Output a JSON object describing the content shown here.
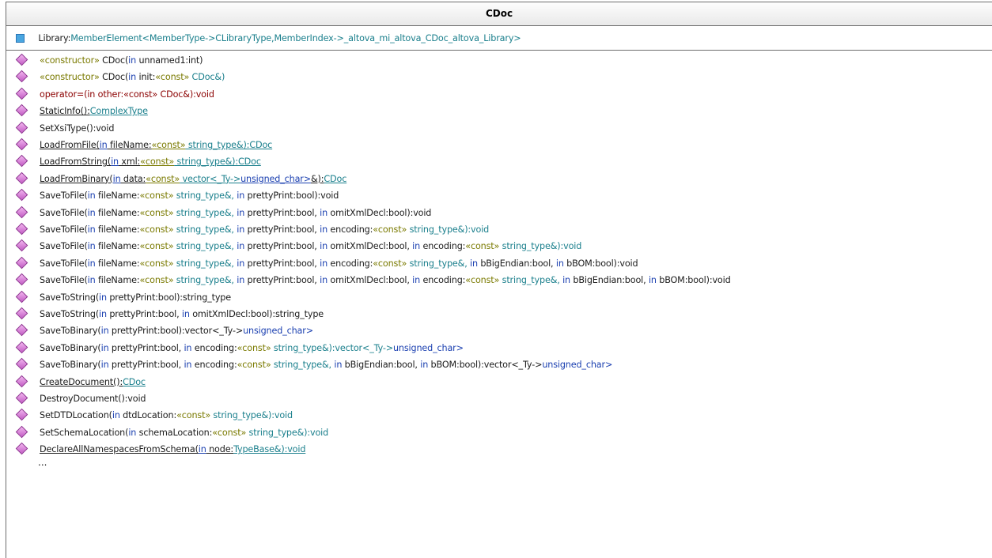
{
  "class_name": "CDoc",
  "attribute": [
    {
      "t": "Library:",
      "c": "plain"
    },
    {
      "t": "MemberElement<MemberType->CLibraryType,MemberIndex->_altova_mi_altova_CDoc_altova_Library>",
      "c": "ty"
    }
  ],
  "operations": [
    {
      "u": false,
      "parts": [
        {
          "t": "«constructor»",
          "c": "st"
        },
        {
          "t": " CDoc(",
          "c": "plain"
        },
        {
          "t": "in",
          "c": "kw"
        },
        {
          "t": " unnamed1:int)",
          "c": "plain"
        }
      ]
    },
    {
      "u": false,
      "parts": [
        {
          "t": "«constructor»",
          "c": "st"
        },
        {
          "t": " CDoc(",
          "c": "plain"
        },
        {
          "t": "in",
          "c": "kw"
        },
        {
          "t": " init:",
          "c": "plain"
        },
        {
          "t": "«const»",
          "c": "st"
        },
        {
          "t": " CDoc&)",
          "c": "ty"
        }
      ]
    },
    {
      "u": false,
      "parts": [
        {
          "t": "operator=(in other:«const» CDoc&):void",
          "c": "red"
        }
      ]
    },
    {
      "u": true,
      "parts": [
        {
          "t": "StaticInfo():",
          "c": "plain"
        },
        {
          "t": "ComplexType",
          "c": "ty"
        }
      ]
    },
    {
      "u": false,
      "parts": [
        {
          "t": "SetXsiType():void",
          "c": "plain"
        }
      ]
    },
    {
      "u": true,
      "parts": [
        {
          "t": "LoadFromFile(",
          "c": "plain"
        },
        {
          "t": "in",
          "c": "kw"
        },
        {
          "t": " fileName:",
          "c": "plain"
        },
        {
          "t": "«const»",
          "c": "st"
        },
        {
          "t": " string_type&):",
          "c": "ty"
        },
        {
          "t": "CDoc",
          "c": "ty"
        }
      ]
    },
    {
      "u": true,
      "parts": [
        {
          "t": "LoadFromString(",
          "c": "plain"
        },
        {
          "t": "in",
          "c": "kw"
        },
        {
          "t": " xml:",
          "c": "plain"
        },
        {
          "t": "«const»",
          "c": "st"
        },
        {
          "t": " string_type&):",
          "c": "ty"
        },
        {
          "t": "CDoc",
          "c": "ty"
        }
      ]
    },
    {
      "u": true,
      "parts": [
        {
          "t": "LoadFromBinary(",
          "c": "plain"
        },
        {
          "t": "in",
          "c": "kw"
        },
        {
          "t": " data:",
          "c": "plain"
        },
        {
          "t": "«const»",
          "c": "st"
        },
        {
          "t": " vector<_Ty->",
          "c": "ty"
        },
        {
          "t": "unsigned_char>",
          "c": "kw"
        },
        {
          "t": "&):",
          "c": "plain"
        },
        {
          "t": "CDoc",
          "c": "ty"
        }
      ]
    },
    {
      "u": false,
      "parts": [
        {
          "t": "SaveToFile(",
          "c": "plain"
        },
        {
          "t": "in",
          "c": "kw"
        },
        {
          "t": " fileName:",
          "c": "plain"
        },
        {
          "t": "«const»",
          "c": "st"
        },
        {
          "t": " string_type&, ",
          "c": "ty"
        },
        {
          "t": "in",
          "c": "kw"
        },
        {
          "t": " prettyPrint:bool):void",
          "c": "plain"
        }
      ]
    },
    {
      "u": false,
      "parts": [
        {
          "t": "SaveToFile(",
          "c": "plain"
        },
        {
          "t": "in",
          "c": "kw"
        },
        {
          "t": " fileName:",
          "c": "plain"
        },
        {
          "t": "«const»",
          "c": "st"
        },
        {
          "t": " string_type&, ",
          "c": "ty"
        },
        {
          "t": "in",
          "c": "kw"
        },
        {
          "t": " prettyPrint:bool, ",
          "c": "plain"
        },
        {
          "t": "in",
          "c": "kw"
        },
        {
          "t": " omitXmlDecl:bool):void",
          "c": "plain"
        }
      ]
    },
    {
      "u": false,
      "parts": [
        {
          "t": "SaveToFile(",
          "c": "plain"
        },
        {
          "t": "in",
          "c": "kw"
        },
        {
          "t": " fileName:",
          "c": "plain"
        },
        {
          "t": "«const»",
          "c": "st"
        },
        {
          "t": " string_type&, ",
          "c": "ty"
        },
        {
          "t": "in",
          "c": "kw"
        },
        {
          "t": " prettyPrint:bool, ",
          "c": "plain"
        },
        {
          "t": "in",
          "c": "kw"
        },
        {
          "t": " encoding:",
          "c": "plain"
        },
        {
          "t": "«const»",
          "c": "st"
        },
        {
          "t": " string_type&):void",
          "c": "ty"
        }
      ]
    },
    {
      "u": false,
      "parts": [
        {
          "t": "SaveToFile(",
          "c": "plain"
        },
        {
          "t": "in",
          "c": "kw"
        },
        {
          "t": " fileName:",
          "c": "plain"
        },
        {
          "t": "«const»",
          "c": "st"
        },
        {
          "t": " string_type&, ",
          "c": "ty"
        },
        {
          "t": "in",
          "c": "kw"
        },
        {
          "t": " prettyPrint:bool, ",
          "c": "plain"
        },
        {
          "t": "in",
          "c": "kw"
        },
        {
          "t": " omitXmlDecl:bool, ",
          "c": "plain"
        },
        {
          "t": "in",
          "c": "kw"
        },
        {
          "t": " encoding:",
          "c": "plain"
        },
        {
          "t": "«const»",
          "c": "st"
        },
        {
          "t": " string_type&):void",
          "c": "ty"
        }
      ]
    },
    {
      "u": false,
      "parts": [
        {
          "t": "SaveToFile(",
          "c": "plain"
        },
        {
          "t": "in",
          "c": "kw"
        },
        {
          "t": " fileName:",
          "c": "plain"
        },
        {
          "t": "«const»",
          "c": "st"
        },
        {
          "t": " string_type&, ",
          "c": "ty"
        },
        {
          "t": "in",
          "c": "kw"
        },
        {
          "t": " prettyPrint:bool, ",
          "c": "plain"
        },
        {
          "t": "in",
          "c": "kw"
        },
        {
          "t": " encoding:",
          "c": "plain"
        },
        {
          "t": "«const»",
          "c": "st"
        },
        {
          "t": " string_type&, ",
          "c": "ty"
        },
        {
          "t": "in",
          "c": "kw"
        },
        {
          "t": " bBigEndian:bool, ",
          "c": "plain"
        },
        {
          "t": "in",
          "c": "kw"
        },
        {
          "t": " bBOM:bool):void",
          "c": "plain"
        }
      ]
    },
    {
      "u": false,
      "parts": [
        {
          "t": "SaveToFile(",
          "c": "plain"
        },
        {
          "t": "in",
          "c": "kw"
        },
        {
          "t": " fileName:",
          "c": "plain"
        },
        {
          "t": "«const»",
          "c": "st"
        },
        {
          "t": " string_type&, ",
          "c": "ty"
        },
        {
          "t": "in",
          "c": "kw"
        },
        {
          "t": " prettyPrint:bool, ",
          "c": "plain"
        },
        {
          "t": "in",
          "c": "kw"
        },
        {
          "t": " omitXmlDecl:bool, ",
          "c": "plain"
        },
        {
          "t": "in",
          "c": "kw"
        },
        {
          "t": " encoding:",
          "c": "plain"
        },
        {
          "t": "«const»",
          "c": "st"
        },
        {
          "t": " string_type&, ",
          "c": "ty"
        },
        {
          "t": "in",
          "c": "kw"
        },
        {
          "t": " bBigEndian:bool, ",
          "c": "plain"
        },
        {
          "t": "in",
          "c": "kw"
        },
        {
          "t": " bBOM:bool):void",
          "c": "plain"
        }
      ]
    },
    {
      "u": false,
      "parts": [
        {
          "t": "SaveToString(",
          "c": "plain"
        },
        {
          "t": "in",
          "c": "kw"
        },
        {
          "t": " prettyPrint:bool):string_type",
          "c": "plain"
        }
      ]
    },
    {
      "u": false,
      "parts": [
        {
          "t": "SaveToString(",
          "c": "plain"
        },
        {
          "t": "in",
          "c": "kw"
        },
        {
          "t": " prettyPrint:bool, ",
          "c": "plain"
        },
        {
          "t": "in",
          "c": "kw"
        },
        {
          "t": " omitXmlDecl:bool):string_type",
          "c": "plain"
        }
      ]
    },
    {
      "u": false,
      "parts": [
        {
          "t": "SaveToBinary(",
          "c": "plain"
        },
        {
          "t": "in",
          "c": "kw"
        },
        {
          "t": " prettyPrint:bool):vector<_Ty->",
          "c": "plain"
        },
        {
          "t": "unsigned_char>",
          "c": "kw"
        }
      ]
    },
    {
      "u": false,
      "parts": [
        {
          "t": "SaveToBinary(",
          "c": "plain"
        },
        {
          "t": "in",
          "c": "kw"
        },
        {
          "t": " prettyPrint:bool, ",
          "c": "plain"
        },
        {
          "t": "in",
          "c": "kw"
        },
        {
          "t": " encoding:",
          "c": "plain"
        },
        {
          "t": "«const»",
          "c": "st"
        },
        {
          "t": " string_type&):vector<_Ty->",
          "c": "ty"
        },
        {
          "t": "unsigned_char>",
          "c": "kw"
        }
      ]
    },
    {
      "u": false,
      "parts": [
        {
          "t": "SaveToBinary(",
          "c": "plain"
        },
        {
          "t": "in",
          "c": "kw"
        },
        {
          "t": " prettyPrint:bool, ",
          "c": "plain"
        },
        {
          "t": "in",
          "c": "kw"
        },
        {
          "t": " encoding:",
          "c": "plain"
        },
        {
          "t": "«const»",
          "c": "st"
        },
        {
          "t": " string_type&, ",
          "c": "ty"
        },
        {
          "t": "in",
          "c": "kw"
        },
        {
          "t": " bBigEndian:bool, ",
          "c": "plain"
        },
        {
          "t": "in",
          "c": "kw"
        },
        {
          "t": " bBOM:bool):vector<_Ty->",
          "c": "plain"
        },
        {
          "t": "unsigned_char>",
          "c": "kw"
        }
      ]
    },
    {
      "u": true,
      "parts": [
        {
          "t": "CreateDocument():",
          "c": "plain"
        },
        {
          "t": "CDoc",
          "c": "ty"
        }
      ]
    },
    {
      "u": false,
      "parts": [
        {
          "t": "DestroyDocument():void",
          "c": "plain"
        }
      ]
    },
    {
      "u": false,
      "parts": [
        {
          "t": "SetDTDLocation(",
          "c": "plain"
        },
        {
          "t": "in",
          "c": "kw"
        },
        {
          "t": " dtdLocation:",
          "c": "plain"
        },
        {
          "t": "«const»",
          "c": "st"
        },
        {
          "t": " string_type&):void",
          "c": "ty"
        }
      ]
    },
    {
      "u": false,
      "parts": [
        {
          "t": "SetSchemaLocation(",
          "c": "plain"
        },
        {
          "t": "in",
          "c": "kw"
        },
        {
          "t": " schemaLocation:",
          "c": "plain"
        },
        {
          "t": "«const»",
          "c": "st"
        },
        {
          "t": " string_type&):void",
          "c": "ty"
        }
      ]
    },
    {
      "u": true,
      "parts": [
        {
          "t": "DeclareAllNamespacesFromSchema(",
          "c": "plain"
        },
        {
          "t": "in",
          "c": "kw"
        },
        {
          "t": " node:",
          "c": "plain"
        },
        {
          "t": "TypeBase&):void",
          "c": "ty"
        }
      ]
    }
  ],
  "ellipsis": "...",
  "icons": {
    "attribute": "attribute-square-icon",
    "operation": "operation-diamond-icon"
  }
}
